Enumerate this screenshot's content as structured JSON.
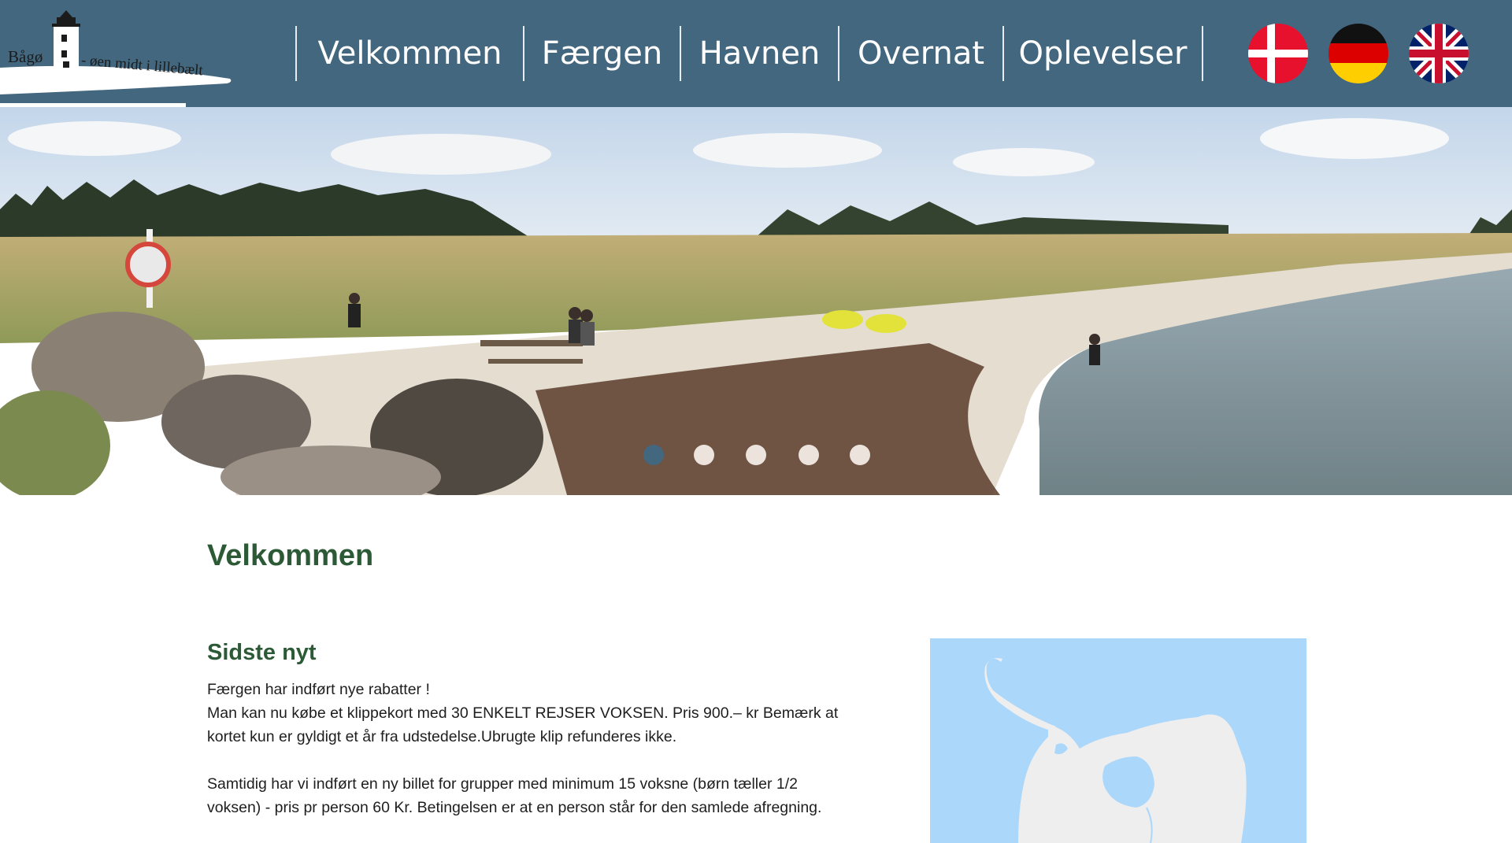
{
  "header": {
    "logo": {
      "name": "Bågø",
      "tagline": "- øen midt i lillebælt"
    },
    "nav": [
      {
        "label": "Velkommen"
      },
      {
        "label": "Færgen"
      },
      {
        "label": "Havnen"
      },
      {
        "label": "Overnat"
      },
      {
        "label": "Oplevelser"
      }
    ],
    "languages": [
      "danish-flag-icon",
      "german-flag-icon",
      "uk-flag-icon"
    ],
    "colors": {
      "bar": "#43677e",
      "heading": "#2d5a36"
    }
  },
  "hero": {
    "slide_count": 5,
    "active_slide": 1
  },
  "main": {
    "title": "Velkommen",
    "news": {
      "heading": "Sidste nyt",
      "line1": "Færgen har indført nye rabatter !",
      "line2": "Man kan nu købe et klippekort med 30 ENKELT REJSER VOKSEN. Pris 900.– kr Bemærk at kortet kun er gyldigt et år fra udstedelse.Ubrugte klip refunderes ikke.",
      "line3": "Samtidig har vi indført en ny billet for grupper med minimum 15 voksne (børn tæller 1/2 voksen) -  pris pr person 60 Kr. Betingelsen er at en person står for den samlede afregning."
    }
  }
}
